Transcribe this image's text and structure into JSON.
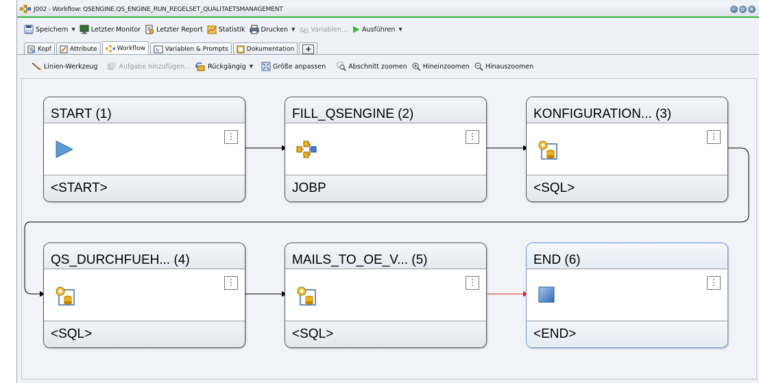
{
  "window": {
    "title": "J002 - Workflow: QSENGINE.QS_ENGINE_RUN_REGELSET_QUALITAETSMANAGEMENT",
    "buttons": [
      "minimize",
      "maximize",
      "close"
    ]
  },
  "toolbar": {
    "save": "Speichern",
    "last_monitor": "Letzter Monitor",
    "last_report": "Letzter Report",
    "statistics": "Statistik",
    "print": "Drucken",
    "variables": "Variablen...",
    "run": "Ausführen"
  },
  "tabs": [
    {
      "label": "Kopf",
      "icon": "header-icon"
    },
    {
      "label": "Attribute",
      "icon": "attributes-icon"
    },
    {
      "label": "Workflow",
      "icon": "workflow-icon",
      "active": true
    },
    {
      "label": "Variablen & Prompts",
      "icon": "variables-icon"
    },
    {
      "label": "Dokumentation",
      "icon": "documentation-icon"
    },
    {
      "label": "+",
      "icon": "add-tab-icon"
    }
  ],
  "workflow_toolbar": {
    "line_tool": "Linien-Werkzeug",
    "add_task": "Aufgabe hinzufügen...",
    "undo": "Rückgängig",
    "fit": "Größe anpassen",
    "zoom_section": "Abschnitt zoomen",
    "zoom_in": "Hineinzoomen",
    "zoom_out": "Hinauszoomen"
  },
  "nodes": [
    {
      "title": "START (1)",
      "type": "<START>",
      "icon": "start-triangle-icon"
    },
    {
      "title": "FILL_QSENGINE (2)",
      "type": "JOBP",
      "icon": "jobplan-icon"
    },
    {
      "title": "KONFIGURATION... (3)",
      "type": "<SQL>",
      "icon": "sql-database-icon"
    },
    {
      "title": "QS_DURCHFUEH... (4)",
      "type": "<SQL>",
      "icon": "sql-database-icon"
    },
    {
      "title": "MAILS_TO_OE_V... (5)",
      "type": "<SQL>",
      "icon": "sql-database-icon"
    },
    {
      "title": "END (6)",
      "type": "<END>",
      "icon": "end-square-icon"
    }
  ],
  "colors": {
    "accent_green": "#2eb82e",
    "arrow_normal": "#000000",
    "arrow_highlight": "#e02020",
    "end_border": "#6b9be0"
  }
}
